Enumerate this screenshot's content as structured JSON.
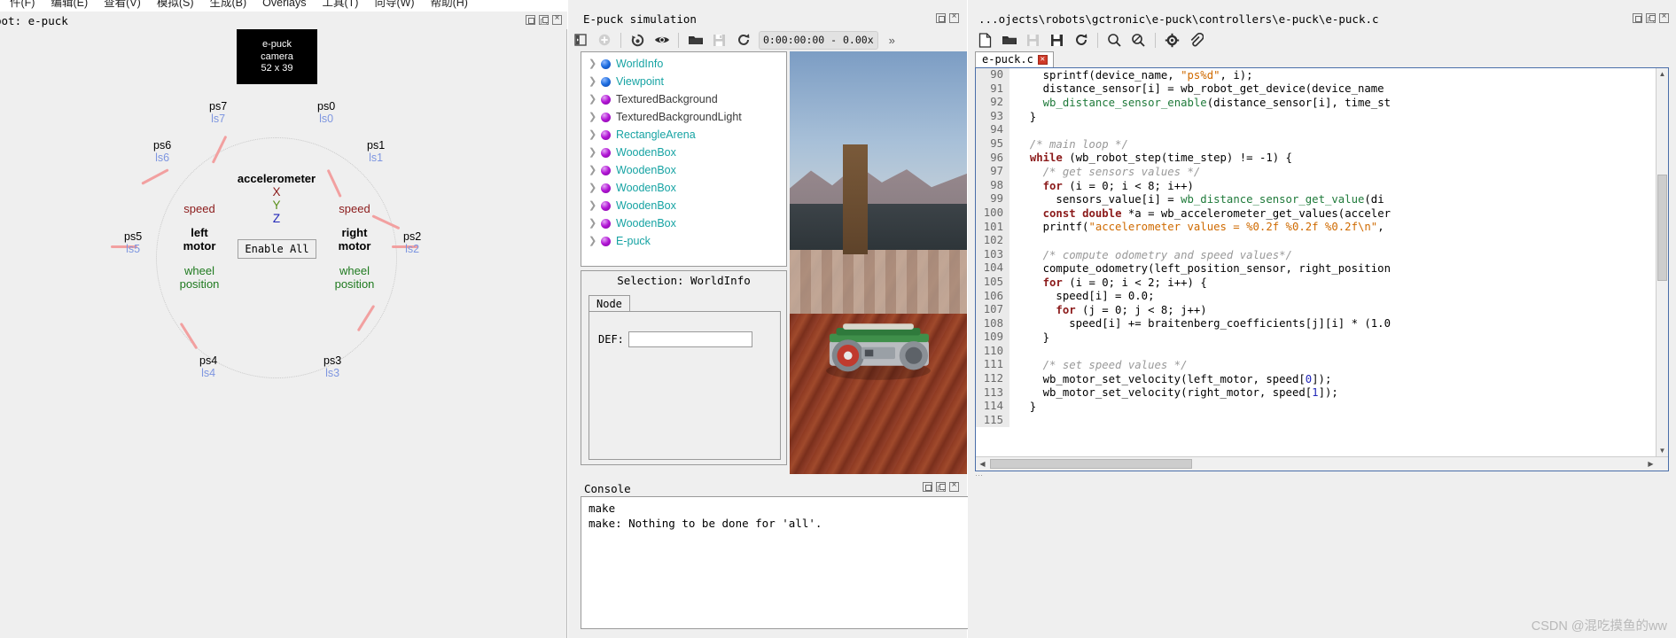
{
  "menubar": {
    "items": [
      {
        "label": "件(F)"
      },
      {
        "label": "编辑(E)"
      },
      {
        "label": "查看(V)"
      },
      {
        "label": "模拟(S)"
      },
      {
        "label": "生成(B)"
      },
      {
        "label": "Overlays"
      },
      {
        "label": "工具(T)"
      },
      {
        "label": "向导(W)"
      },
      {
        "label": "帮助(H)"
      }
    ]
  },
  "robot_window": {
    "title": "bot: e-puck",
    "camera": {
      "line1": "e-puck",
      "line2": "camera",
      "line3": "52 x 39"
    },
    "enable_all_label": "Enable All",
    "accelerometer": {
      "title": "accelerometer",
      "x": "X",
      "y": "Y",
      "z": "Z"
    },
    "left_motor": {
      "speed": "speed",
      "name_line1": "left",
      "name_line2": "motor",
      "wheel_line1": "wheel",
      "wheel_line2": "position"
    },
    "right_motor": {
      "speed": "speed",
      "name_line1": "right",
      "name_line2": "motor",
      "wheel_line1": "wheel",
      "wheel_line2": "position"
    },
    "sensors": [
      {
        "ps": "ps0",
        "ls": "ls0"
      },
      {
        "ps": "ps1",
        "ls": "ls1"
      },
      {
        "ps": "ps2",
        "ls": "ls2"
      },
      {
        "ps": "ps3",
        "ls": "ls3"
      },
      {
        "ps": "ps4",
        "ls": "ls4"
      },
      {
        "ps": "ps5",
        "ls": "ls5"
      },
      {
        "ps": "ps6",
        "ls": "ls6"
      },
      {
        "ps": "ps7",
        "ls": "ls7"
      }
    ]
  },
  "simulation_window": {
    "title": "E-puck simulation",
    "time_display": "0:00:00:00 -  0.00x",
    "overflow_label": "»",
    "tree": [
      {
        "label": "WorldInfo",
        "dot": "blue"
      },
      {
        "label": "Viewpoint",
        "dot": "blue"
      },
      {
        "label": "TexturedBackground",
        "dot": "purple",
        "dark": true
      },
      {
        "label": "TexturedBackgroundLight",
        "dot": "purple",
        "dark": true
      },
      {
        "label": "RectangleArena",
        "dot": "purple"
      },
      {
        "label": "WoodenBox",
        "dot": "purple"
      },
      {
        "label": "WoodenBox",
        "dot": "purple"
      },
      {
        "label": "WoodenBox",
        "dot": "purple"
      },
      {
        "label": "WoodenBox",
        "dot": "purple"
      },
      {
        "label": "WoodenBox",
        "dot": "purple"
      },
      {
        "label": "E-puck",
        "dot": "purple"
      }
    ],
    "selection": {
      "title": "Selection: WorldInfo",
      "tab_label": "Node",
      "def_label": "DEF:",
      "def_value": ""
    }
  },
  "console_window": {
    "title": "Console",
    "lines": [
      "make",
      "make: Nothing to be done for 'all'."
    ]
  },
  "editor_window": {
    "title": "...ojects\\robots\\gctronic\\e-puck\\controllers\\e-puck\\e-puck.c",
    "tab_label": "e-puck.c",
    "first_line_number": 90,
    "code": [
      {
        "n": 90,
        "parts": [
          {
            "t": "    sprintf(device_name, ",
            "c": ""
          },
          {
            "t": "\"ps%d\"",
            "c": "st"
          },
          {
            "t": ", i);",
            "c": ""
          }
        ]
      },
      {
        "n": 91,
        "parts": [
          {
            "t": "    distance_sensor[i] = wb_robot_get_device(device_name",
            "c": ""
          }
        ]
      },
      {
        "n": 92,
        "parts": [
          {
            "t": "    ",
            "c": ""
          },
          {
            "t": "wb_distance_sensor_enable",
            "c": "fn"
          },
          {
            "t": "(distance_sensor[i], time_st",
            "c": ""
          }
        ]
      },
      {
        "n": 93,
        "parts": [
          {
            "t": "  }",
            "c": ""
          }
        ]
      },
      {
        "n": 94,
        "parts": [
          {
            "t": "",
            "c": ""
          }
        ]
      },
      {
        "n": 95,
        "parts": [
          {
            "t": "  /* main loop */",
            "c": "cm"
          }
        ]
      },
      {
        "n": 96,
        "parts": [
          {
            "t": "  ",
            "c": ""
          },
          {
            "t": "while",
            "c": "k"
          },
          {
            "t": " (wb_robot_step(time_step) != -1) {",
            "c": ""
          }
        ]
      },
      {
        "n": 97,
        "parts": [
          {
            "t": "    /* get sensors values */",
            "c": "cm"
          }
        ]
      },
      {
        "n": 98,
        "parts": [
          {
            "t": "    ",
            "c": ""
          },
          {
            "t": "for",
            "c": "k"
          },
          {
            "t": " (i = 0; i < 8; i++)",
            "c": ""
          }
        ]
      },
      {
        "n": 99,
        "parts": [
          {
            "t": "      sensors_value[i] = ",
            "c": ""
          },
          {
            "t": "wb_distance_sensor_get_value",
            "c": "fn"
          },
          {
            "t": "(di",
            "c": ""
          }
        ]
      },
      {
        "n": 100,
        "parts": [
          {
            "t": "    ",
            "c": ""
          },
          {
            "t": "const",
            "c": "k"
          },
          {
            "t": " ",
            "c": ""
          },
          {
            "t": "double",
            "c": "k"
          },
          {
            "t": " *a = wb_accelerometer_get_values(acceler",
            "c": ""
          }
        ]
      },
      {
        "n": 101,
        "parts": [
          {
            "t": "    printf(",
            "c": ""
          },
          {
            "t": "\"accelerometer values = %0.2f %0.2f %0.2f\\n\"",
            "c": "st"
          },
          {
            "t": ",",
            "c": ""
          }
        ]
      },
      {
        "n": 102,
        "parts": [
          {
            "t": "",
            "c": ""
          }
        ]
      },
      {
        "n": 103,
        "parts": [
          {
            "t": "    /* compute odometry and speed values*/",
            "c": "cm"
          }
        ]
      },
      {
        "n": 104,
        "parts": [
          {
            "t": "    compute_odometry(left_position_sensor, right_position",
            "c": ""
          }
        ]
      },
      {
        "n": 105,
        "parts": [
          {
            "t": "    ",
            "c": ""
          },
          {
            "t": "for",
            "c": "k"
          },
          {
            "t": " (i = 0; i < 2; i++) {",
            "c": ""
          }
        ]
      },
      {
        "n": 106,
        "parts": [
          {
            "t": "      speed[i] = 0.0;",
            "c": ""
          }
        ]
      },
      {
        "n": 107,
        "parts": [
          {
            "t": "      ",
            "c": ""
          },
          {
            "t": "for",
            "c": "k"
          },
          {
            "t": " (j = 0; j < 8; j++)",
            "c": ""
          }
        ]
      },
      {
        "n": 108,
        "parts": [
          {
            "t": "        speed[i] += braitenberg_coefficients[j][i] * (1.0",
            "c": ""
          }
        ]
      },
      {
        "n": 109,
        "parts": [
          {
            "t": "    }",
            "c": ""
          }
        ]
      },
      {
        "n": 110,
        "parts": [
          {
            "t": "",
            "c": ""
          }
        ]
      },
      {
        "n": 111,
        "parts": [
          {
            "t": "    /* set speed values */",
            "c": "cm"
          }
        ]
      },
      {
        "n": 112,
        "parts": [
          {
            "t": "    wb_motor_set_velocity(left_motor, speed[",
            "c": ""
          },
          {
            "t": "0",
            "c": "nm"
          },
          {
            "t": "]);",
            "c": ""
          }
        ]
      },
      {
        "n": 113,
        "parts": [
          {
            "t": "    wb_motor_set_velocity(right_motor, speed[",
            "c": ""
          },
          {
            "t": "1",
            "c": "nm"
          },
          {
            "t": "]);",
            "c": ""
          }
        ]
      },
      {
        "n": 114,
        "parts": [
          {
            "t": "  }",
            "c": ""
          }
        ]
      },
      {
        "n": 115,
        "parts": [
          {
            "t": "",
            "c": ""
          }
        ]
      }
    ],
    "toolbar_icons": [
      "new-file-icon",
      "open-folder-icon",
      "save-icon",
      "save-all-icon",
      "reload-icon",
      "find-icon",
      "find-replace-icon",
      "settings-gear-icon",
      "attach-icon"
    ]
  },
  "watermark": "CSDN @混吃摸鱼的ww",
  "colors": {
    "tree_label": "#16a3a3",
    "speed": "#8b1a1a",
    "wheel_position": "#1f7a1f",
    "sensor_sub": "#7e96e0",
    "spoke": "#f2a0a0",
    "editor_border": "#4a6ea9"
  }
}
